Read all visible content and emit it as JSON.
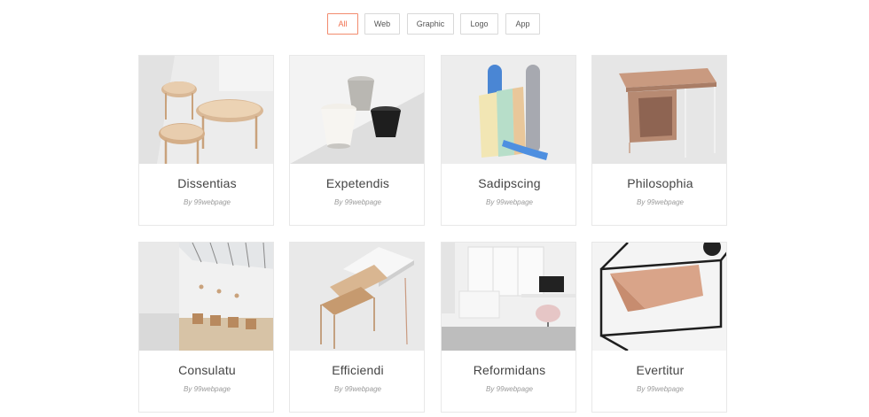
{
  "filters": {
    "items": [
      {
        "label": "All",
        "active": true
      },
      {
        "label": "Web",
        "active": false
      },
      {
        "label": "Graphic",
        "active": false
      },
      {
        "label": "Logo",
        "active": false
      },
      {
        "label": "App",
        "active": false
      }
    ]
  },
  "portfolio": {
    "items": [
      {
        "title": "Dissentias",
        "author": "By 99webpage",
        "image": "wooden-tables-image"
      },
      {
        "title": "Expetendis",
        "author": "By 99webpage",
        "image": "ceramic-cups-image"
      },
      {
        "title": "Sadipscing",
        "author": "By 99webpage",
        "image": "colorful-blocks-image"
      },
      {
        "title": "Philosophia",
        "author": "By 99webpage",
        "image": "copper-desk-image"
      },
      {
        "title": "Consulatu",
        "author": "By 99webpage",
        "image": "cafe-interior-image"
      },
      {
        "title": "Efficiendi",
        "author": "By 99webpage",
        "image": "metal-side-table-image"
      },
      {
        "title": "Reformidans",
        "author": "By 99webpage",
        "image": "office-room-image"
      },
      {
        "title": "Evertitur",
        "author": "By 99webpage",
        "image": "wire-frame-chair-image"
      }
    ]
  }
}
